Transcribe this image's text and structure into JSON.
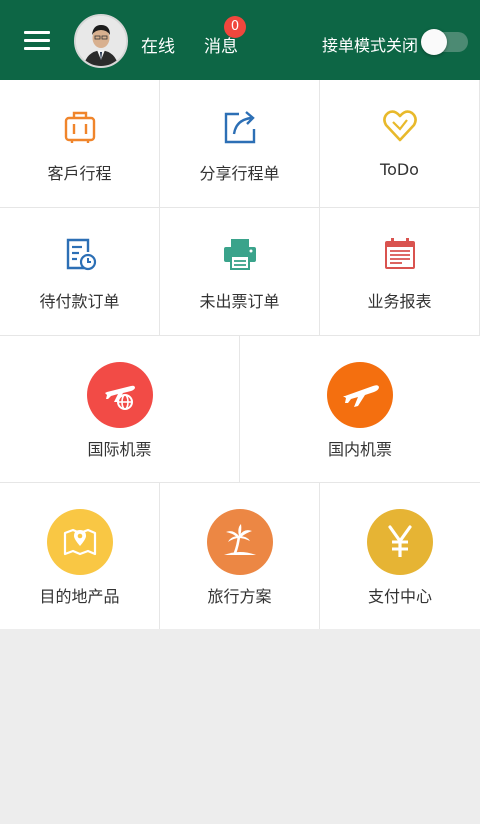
{
  "header": {
    "status": "在线",
    "messages_label": "消息",
    "message_count": "0",
    "mode_label": "接单模式关闭"
  },
  "grid": {
    "row1": [
      "客戶行程",
      "分享行程单",
      "ToDo"
    ],
    "row2": [
      "待付款订单",
      "未出票订单",
      "业务报表"
    ],
    "row3": [
      "国际机票",
      "国内机票"
    ],
    "row4": [
      "目的地产品",
      "旅行方案",
      "支付中心"
    ]
  },
  "icons": {
    "row1": [
      "luggage-icon",
      "share-icon",
      "heart-icon"
    ],
    "row2": [
      "pending-order-icon",
      "printer-icon",
      "calendar-report-icon"
    ],
    "row3": [
      "international-flight-icon",
      "domestic-flight-icon"
    ],
    "row4": [
      "map-pin-icon",
      "palm-tree-icon",
      "yen-icon"
    ]
  },
  "colors": {
    "header_bg": "#0d6645",
    "badge": "#f0473d",
    "orange": "#f0852b",
    "blue": "#2c6fb5",
    "gold": "#e8b92b",
    "teal": "#3aa38b",
    "red": "#d9534f",
    "intl_circle": "#f24b46",
    "domestic_circle": "#f46f0f",
    "dest_circle": "#f9c744",
    "plan_circle": "#ec8744",
    "pay_circle": "#e6b434"
  }
}
